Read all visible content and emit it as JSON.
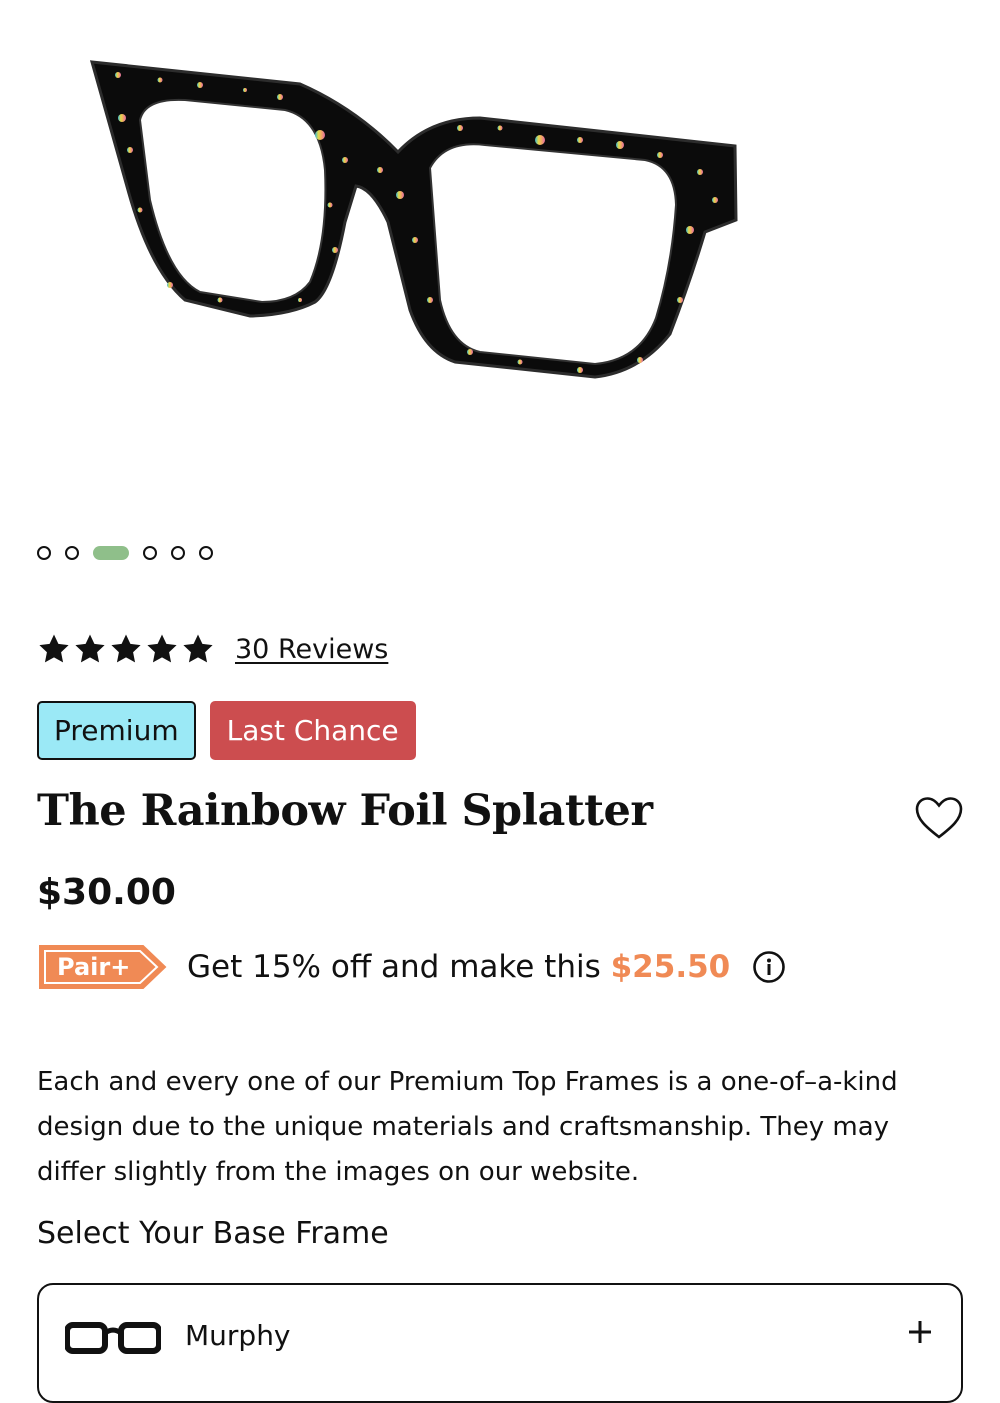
{
  "product": {
    "image_description_icon": "glasses-frame-image",
    "carousel": {
      "count": 6,
      "active_index": 2
    },
    "rating": {
      "stars": 5,
      "max": 5,
      "reviews_label": "30 Reviews"
    },
    "badges": [
      {
        "label": "Premium",
        "color": "#9be9f6"
      },
      {
        "label": "Last Chance",
        "color": "#cc4d4f"
      }
    ],
    "title": "The Rainbow Foil Splatter",
    "price": "$30.00",
    "promo": {
      "tag_label": "Pair+",
      "tag_color": "#f08a55",
      "text": "Get 15% off and make this ",
      "discount_price": "$25.50"
    },
    "description": "Each and every one of our Premium Top Frames is a one-of–a-kind design due to the unique materials and craftsmanship. They may differ slightly from the images on our website.",
    "select_heading": "Select Your Base Frame",
    "base_frame": {
      "name": "Murphy"
    }
  },
  "colors": {
    "accent_green": "#8fbf8a",
    "text": "#111111"
  }
}
